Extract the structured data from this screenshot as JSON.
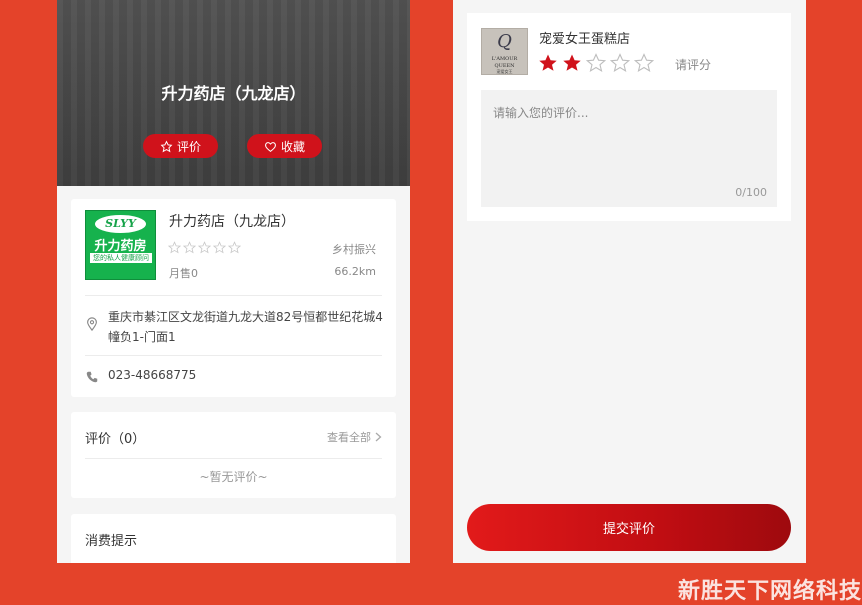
{
  "left": {
    "hero": {
      "title": "升力药店（九龙店）",
      "rate_button": "评价",
      "favorite_button": "收藏"
    },
    "shop": {
      "logo_text": "SLYY",
      "logo_brand": "升力药房",
      "logo_tagline": "您的私人健康顾问",
      "name": "升力药店（九龙店）",
      "category": "乡村振兴",
      "sales": "月售0",
      "distance": "66.2km",
      "rating": 0,
      "address": "重庆市綦江区文龙街道九龙大道82号恒都世纪花城4幢负1-门面1",
      "phone": "023-48668775"
    },
    "reviews": {
      "title": "评价（0）",
      "view_all": "查看全部",
      "empty": "~暂无评价~"
    },
    "tips": {
      "title": "消费提示"
    }
  },
  "right": {
    "shop": {
      "name": "宠爱女王蛋糕店",
      "logo_mark": "Q",
      "logo_line1": "L'AMOUR",
      "logo_line2": "QUEEN",
      "logo_line3": "宠爱女王",
      "rating": 2,
      "rate_hint": "请评分"
    },
    "review_input": {
      "placeholder": "请输入您的评价...",
      "counter": "0/100"
    },
    "submit_label": "提交评价"
  },
  "watermark": "新胜天下网络科技",
  "colors": {
    "accent": "#d0121b",
    "background": "#e4432a",
    "star_filled": "#d0121b",
    "star_empty": "#c8c8c8"
  }
}
